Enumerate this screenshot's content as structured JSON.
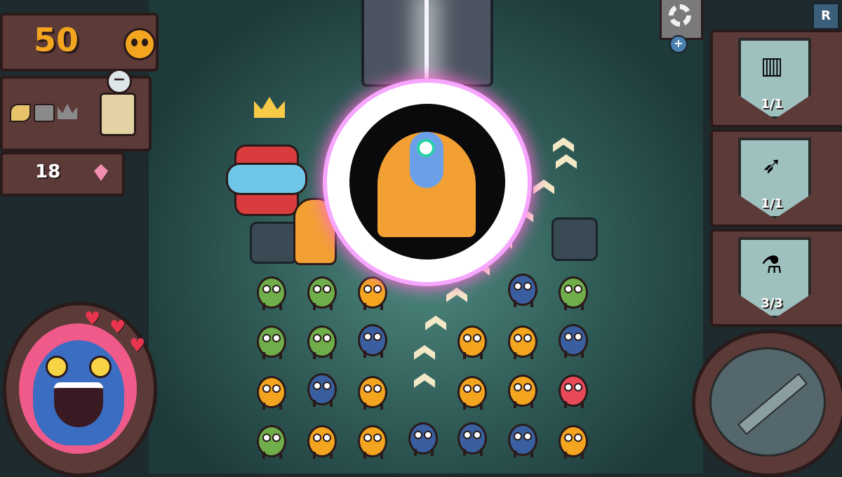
{
  "hud": {
    "score": "50",
    "gems": "18",
    "progress_icons": [
      "leaf-icon",
      "chest-icon",
      "crown-icon"
    ],
    "minus_symbol": "−",
    "plus_symbol": "+",
    "r_label": "R"
  },
  "player": {
    "hearts": 3,
    "heart_glyph": "♥"
  },
  "items": [
    {
      "name": "shield-door",
      "count": "1/1",
      "glyph": "▥"
    },
    {
      "name": "arrow",
      "count": "1/1",
      "glyph": "➶"
    },
    {
      "name": "potion",
      "count": "3/3",
      "glyph": "⚗"
    }
  ],
  "colors": {
    "accent_gold": "#f4a51f",
    "wood": "#5b3a38",
    "heart_red": "#e8344c"
  }
}
